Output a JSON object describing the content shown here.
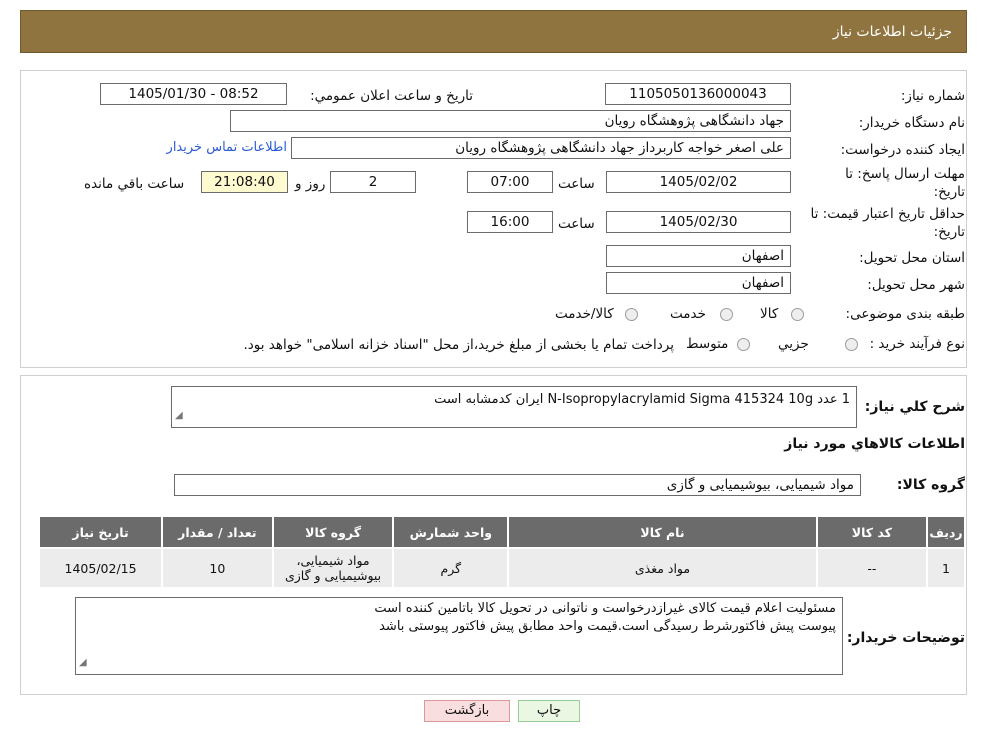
{
  "header": {
    "title": "جزئیات اطلاعات نیاز"
  },
  "form": {
    "need_number_label": "شماره نیاز:",
    "need_number": "1105050136000043",
    "announce_label": "تاریخ و ساعت اعلان عمومي:",
    "announce_value": "1405/01/30 - 08:52",
    "buyer_org_label": "نام دستگاه خريدار:",
    "buyer_org": "جهاد دانشگاهی پژوهشگاه رویان",
    "requester_label": "ايجاد کننده درخواست:",
    "requester": "علی اصغر خواجه کاربرداز جهاد دانشگاهی پژوهشگاه رویان",
    "contact_link": "اطلاعات تماس خريدار",
    "reply_deadline_label_1": "مهلت ارسال پاسخ: تا",
    "reply_deadline_label_2": "تاريخ:",
    "reply_date": "1405/02/02",
    "time_label": "ساعت",
    "reply_time": "07:00",
    "days_value": "2",
    "days_label": "روز و",
    "remaining_time": "21:08:40",
    "remaining_label": "ساعت باقي مانده",
    "validity_label_1": "حداقل تاريخ اعتبار قيمت: تا",
    "validity_label_2": "تاريخ:",
    "validity_date": "1405/02/30",
    "validity_time": "16:00",
    "province_label": "استان محل تحويل:",
    "province": "اصفهان",
    "city_label": "شهر محل تحويل:",
    "city": "اصفهان",
    "category_label": "طبقه بندی موضوعی:",
    "category_options": [
      "کالا",
      "خدمت",
      "کالا/خدمت"
    ],
    "process_label": "نوع فرآيند خريد :",
    "process_options": [
      "جزيي",
      "متوسط"
    ],
    "process_note": "پرداخت تمام يا بخشی از مبلغ خريد،از محل \"اسناد خزانه اسلامی\" خواهد بود."
  },
  "summary": {
    "label": "شرح كلي نياز:",
    "text": "1 عدد        N-Isopropylacrylamid       Sigma      415324   10g   ایران کدمشابه است"
  },
  "goods": {
    "section_title": "اطلاعات كالاهاي مورد نياز",
    "group_label": "گروه كالا:",
    "group_value": "مواد شیمیایی، بیوشیمیایی و  گازی",
    "columns": [
      "رديف",
      "کد کالا",
      "نام کالا",
      "واحد شمارش",
      "گروه کالا",
      "تعداد / مقدار",
      "تاريخ نياز"
    ],
    "rows": [
      [
        "1",
        "--",
        "مواد مغذی",
        "گرم",
        "مواد شیمیایی، بیوشیمیایی و گازی",
        "10",
        "1405/02/15"
      ]
    ]
  },
  "notes": {
    "label": "توضيحات خريدار:",
    "lines": [
      "مسئولیت اعلام قیمت کالای غیرازدرخواست و ناتوانی در تحویل کالا باتامین کننده است",
      "پیوست پیش فاکتورشرط رسیدگی است.قیمت واحد مطابق پیش فاکتور پیوستی باشد"
    ]
  },
  "buttons": {
    "print": "چاپ",
    "back": "بازگشت"
  },
  "colors": {
    "header_bg": "#8f7440",
    "table_header_bg": "#6b6b6b",
    "print_btn_bg": "#eaf7e2",
    "back_btn_bg": "#f8dede"
  }
}
